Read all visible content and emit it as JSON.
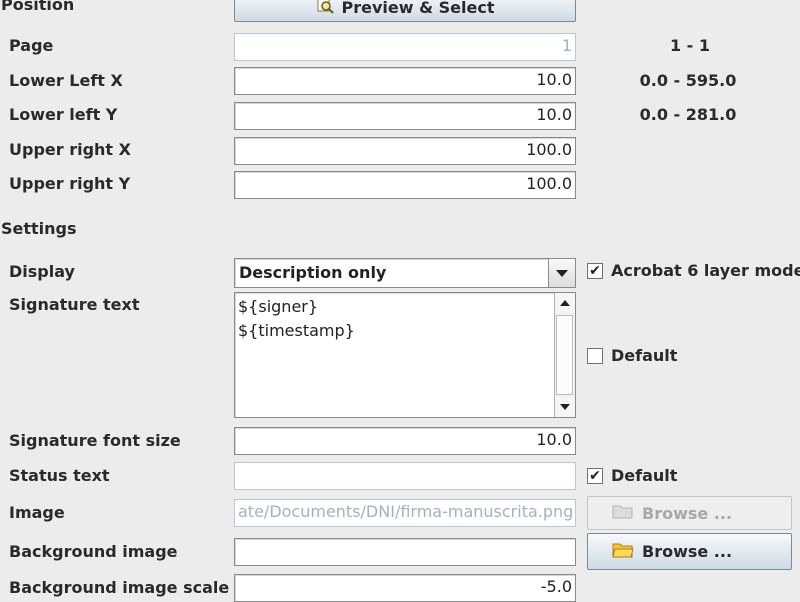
{
  "position": {
    "section_title": "Position",
    "preview_button": "Preview & Select",
    "preview_icon": "magnifier-icon",
    "page": {
      "label": "Page",
      "value": "1",
      "range": "1 - 1"
    },
    "lower_left_x": {
      "label": "Lower Left X",
      "value": "10.0",
      "range": "0.0 - 595.0"
    },
    "lower_left_y": {
      "label": "Lower left Y",
      "value": "10.0",
      "range": "0.0 - 281.0"
    },
    "upper_right_x": {
      "label": "Upper right X",
      "value": "100.0"
    },
    "upper_right_y": {
      "label": "Upper right Y",
      "value": "100.0"
    }
  },
  "settings": {
    "section_title": "Settings",
    "display": {
      "label": "Display",
      "selected": "Description only"
    },
    "acrobat6": {
      "label": "Acrobat 6 layer mode",
      "checked": true
    },
    "signature_text": {
      "label": "Signature text",
      "line1": "${signer}",
      "line2": "${timestamp}"
    },
    "signature_text_default": {
      "label": "Default",
      "checked": false
    },
    "font_size": {
      "label": "Signature font size",
      "value": "10.0"
    },
    "status_text": {
      "label": "Status text",
      "value": ""
    },
    "status_default": {
      "label": "Default",
      "checked": true
    },
    "image": {
      "label": "Image",
      "value": "ate/Documents/DNI/firma-manuscrita.png",
      "browse": "Browse ..."
    },
    "background_image": {
      "label": "Background image",
      "value": "",
      "browse": "Browse ..."
    },
    "background_scale": {
      "label": "Background image scale",
      "value": "-5.0"
    }
  },
  "icons": {
    "folder": "folder-icon",
    "check": "✔"
  }
}
